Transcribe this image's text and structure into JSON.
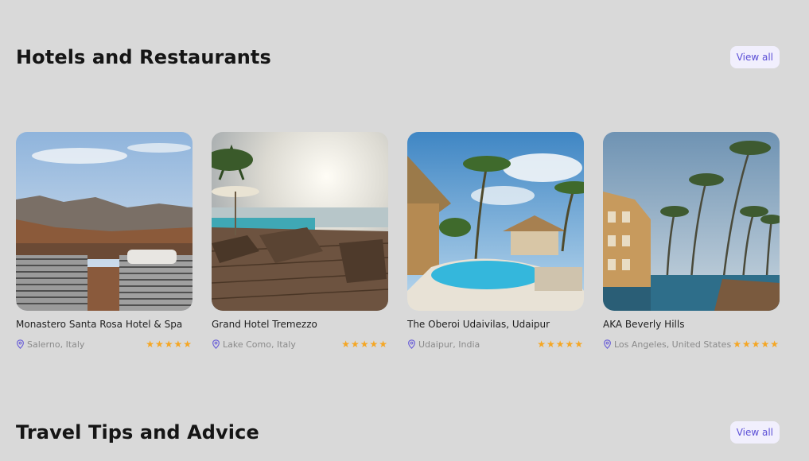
{
  "sections": [
    {
      "title": "Hotels and Restaurants",
      "view_all": "View all"
    },
    {
      "title": "Travel Tips and Advice",
      "view_all": "View all"
    }
  ],
  "cards": [
    {
      "name": "Monastero Santa Rosa Hotel & Spa",
      "location": "Salerno, Italy",
      "rating": 5,
      "stars": "★★★★★",
      "icon": "location-pin-icon"
    },
    {
      "name": "Grand Hotel Tremezzo",
      "location": "Lake Como, Italy",
      "rating": 5,
      "stars": "★★★★★",
      "icon": "location-pin-icon"
    },
    {
      "name": "The Oberoi Udaivilas, Udaipur",
      "location": "Udaipur, India",
      "rating": 5,
      "stars": "★★★★★",
      "icon": "location-pin-icon"
    },
    {
      "name": "AKA Beverly Hills",
      "location": "Los Angeles, United States",
      "rating": 5,
      "stars": "★★★★★",
      "icon": "location-pin-icon"
    }
  ],
  "colors": {
    "accent": "#5b4fd6",
    "star": "#f5a623",
    "background": "#d9d9d9"
  }
}
